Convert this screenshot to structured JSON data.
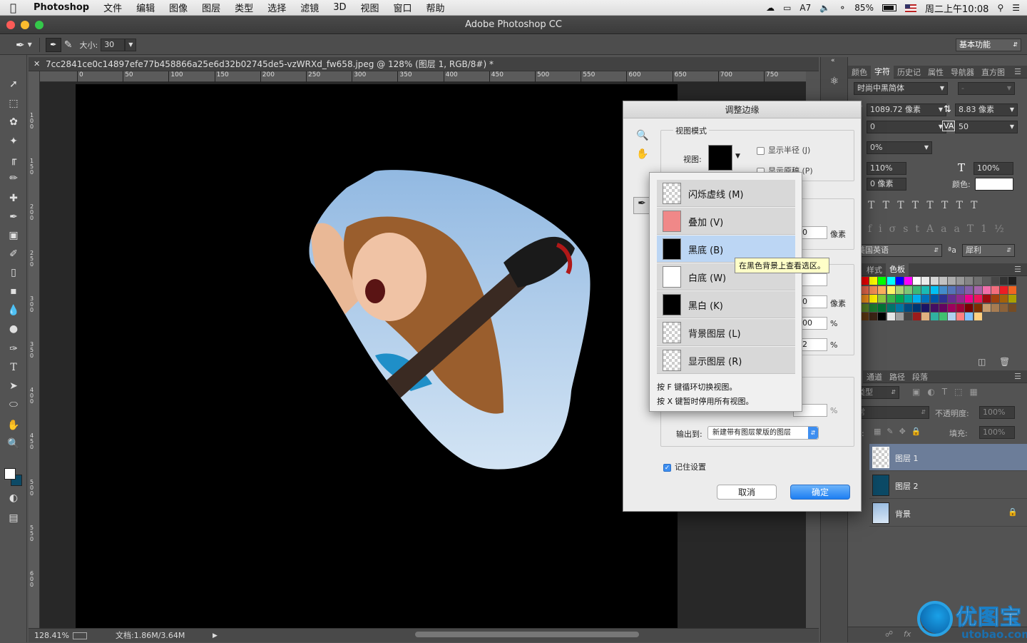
{
  "menubar": {
    "apple": "",
    "app": "Photoshop",
    "items": [
      "文件",
      "编辑",
      "图像",
      "图层",
      "类型",
      "选择",
      "滤镜",
      "3D",
      "视图",
      "窗口",
      "帮助"
    ],
    "status": {
      "ai": "7",
      "battery": "85%",
      "clock": "周二上午10:08"
    }
  },
  "window": {
    "title": "Adobe Photoshop CC"
  },
  "options": {
    "size_label": "大小:",
    "size_value": "30",
    "workspace": "基本功能"
  },
  "document": {
    "tab": "7cc2841ce0c14897efe77b458866a25e6d32b02745de5-vzWRXd_fw658.jpeg @ 128% (图层 1, RGB/8#) *",
    "ruler_ticks": [
      "0",
      "50",
      "100",
      "150",
      "200",
      "250",
      "300",
      "350",
      "400",
      "450",
      "500",
      "550",
      "600",
      "650",
      "700",
      "750"
    ],
    "vruler_ticks": [
      "1\n0\n0",
      "1\n5\n0",
      "2\n0\n0",
      "2\n5\n0",
      "3\n0\n0",
      "3\n5\n0",
      "4\n0\n0",
      "4\n5\n0",
      "5\n0\n0",
      "5\n5\n0",
      "6\n0\n0"
    ]
  },
  "status": {
    "zoom": "128.41%",
    "doc": "文档:1.86M/3.64M"
  },
  "char_panel": {
    "tabs": [
      "颜色",
      "字符",
      "历史记",
      "属性",
      "导航器",
      "直方图"
    ],
    "font": "时尚中黑简体",
    "font_style": "-",
    "size": "1089.72 像素",
    "leading": "8.83 像素",
    "kerning": "0",
    "tracking": "50",
    "scale_pct": "0%",
    "vscale": "110%",
    "hscale": "100%",
    "baseline": "0 像素",
    "color_label": "颜色:",
    "lang": "美国英语",
    "aa_label": "a",
    "aa": "犀利"
  },
  "swatch_panel": {
    "tabs": [
      "整",
      "样式",
      "色板"
    ]
  },
  "layers_panel": {
    "tabs": [
      "层",
      "通道",
      "路径",
      "段落"
    ],
    "filter": "类型",
    "blend": "常",
    "opacity_label": "不透明度:",
    "opacity": "100%",
    "lock_label": "定:",
    "fill_label": "填充:",
    "fill": "100%",
    "layers": [
      {
        "name": "图层 1"
      },
      {
        "name": "图层 2"
      },
      {
        "name": "背景"
      }
    ]
  },
  "dialog": {
    "title": "调整边缘",
    "view_mode": "视图模式",
    "view_label": "视图:",
    "show_radius": "显示半径 (J)",
    "show_original": "显示原稿 (P)",
    "unit1": "像素",
    "unit2": "像素",
    "pct1": "%",
    "pct2": "%",
    "pct3": "%",
    "val1": "0",
    "val2": "0",
    "val3": "00",
    "val4": "2",
    "output_label": "输出到:",
    "output_value": "新建带有图层蒙版的图层",
    "remember": "记住设置",
    "cancel": "取消",
    "ok": "确定"
  },
  "view_menu": {
    "options": [
      {
        "label": "闪烁虚线 (M)"
      },
      {
        "label": "叠加 (V)"
      },
      {
        "label": "黑底 (B)"
      },
      {
        "label": "白底 (W)"
      },
      {
        "label": "黑白 (K)"
      },
      {
        "label": "背景图层 (L)"
      },
      {
        "label": "显示图层 (R)"
      }
    ],
    "hint1": "按 F 键循环切换视图。",
    "hint2": "按 X 键暂时停用所有视图。",
    "tooltip": "在黑色背景上查看选区。"
  },
  "watermark": {
    "text": "优图宝",
    "url": "utobao.com"
  }
}
